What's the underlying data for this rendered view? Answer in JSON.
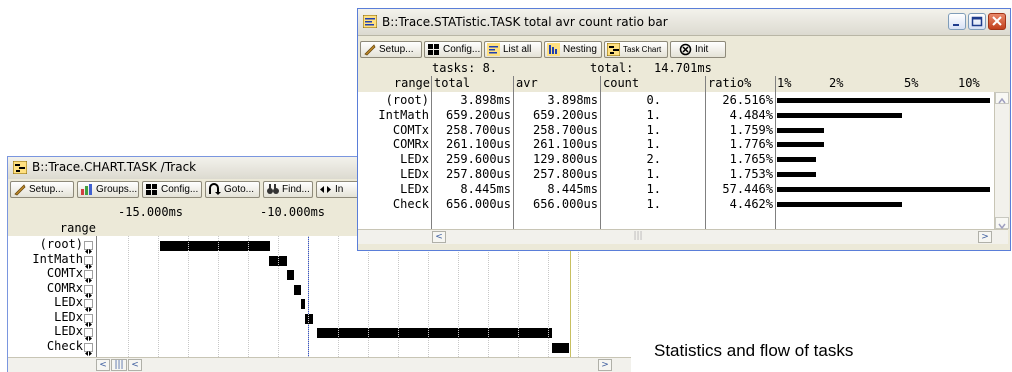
{
  "chart_window": {
    "title": "B::Trace.CHART.TASK /Track",
    "toolbar": {
      "setup": "Setup...",
      "groups": "Groups...",
      "config": "Config...",
      "goto": "Goto...",
      "find": "Find...",
      "in": "In"
    },
    "range_header": "range",
    "time_ticks": [
      "-15.000ms",
      "-10.000ms"
    ],
    "rows": [
      "(root)",
      "IntMath",
      "COMTx",
      "COMRx",
      "LEDx",
      "LEDx",
      "LEDx",
      "Check"
    ],
    "scroll_left_glyph": "<",
    "scroll_mid_glyph": "|||",
    "scroll_right_glyph": ">"
  },
  "stat_window": {
    "title": "B::Trace.STATistic.TASK total avr count ratio bar",
    "toolbar": {
      "setup": "Setup...",
      "config": "Config...",
      "listall": "List all",
      "nesting": "Nesting",
      "taskchart": "Task Chart",
      "init": "Init"
    },
    "tasks_label": "tasks: 8.",
    "total_label": "total:",
    "total_value": "14.701ms",
    "headers": {
      "range": "range",
      "total": "total",
      "avr": "avr",
      "count": "count",
      "ratio": "ratio%",
      "p1": "1%",
      "p2": "2%",
      "p5": "5%",
      "p10": "10%"
    },
    "rows": [
      {
        "range": "(root)",
        "total": "3.898ms",
        "avr": "3.898ms",
        "count": "0.",
        "ratio": "26.516%"
      },
      {
        "range": "IntMath",
        "total": "659.200us",
        "avr": "659.200us",
        "count": "1.",
        "ratio": "4.484%"
      },
      {
        "range": "COMTx",
        "total": "258.700us",
        "avr": "258.700us",
        "count": "1.",
        "ratio": "1.759%"
      },
      {
        "range": "COMRx",
        "total": "261.100us",
        "avr": "261.100us",
        "count": "1.",
        "ratio": "1.776%"
      },
      {
        "range": "LEDx",
        "total": "259.600us",
        "avr": "129.800us",
        "count": "2.",
        "ratio": "1.765%"
      },
      {
        "range": "LEDx",
        "total": "257.800us",
        "avr": "257.800us",
        "count": "1.",
        "ratio": "1.753%"
      },
      {
        "range": "LEDx",
        "total": "8.445ms",
        "avr": "8.445ms",
        "count": "1.",
        "ratio": "57.446%"
      },
      {
        "range": "Check",
        "total": "656.000us",
        "avr": "656.000us",
        "count": "1.",
        "ratio": "4.462%"
      }
    ],
    "scroll_left_glyph": "<",
    "scroll_mid_glyph": "|||",
    "scroll_right_glyph": ">"
  },
  "caption": "Statistics and flow of tasks"
}
